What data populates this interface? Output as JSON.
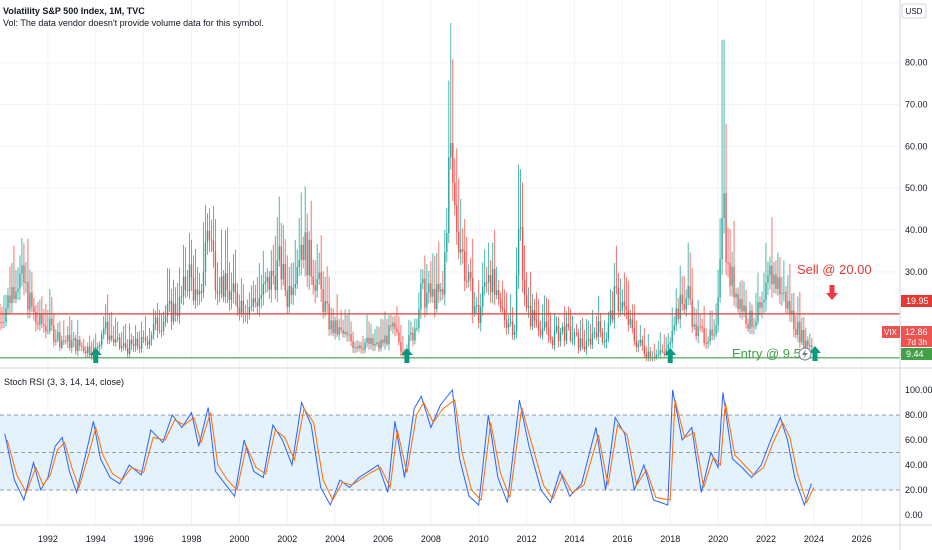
{
  "header": {
    "title": "Volatility S&P 500 Index, 1M, TVC",
    "volume_note": "Vol: The data vendor doesn't provide volume data for this symbol.",
    "currency": "USD"
  },
  "indicator": {
    "title": "Stoch RSI (3, 3, 14, 14, close)"
  },
  "annotations": {
    "sell_label": "Sell @ 20.00",
    "entry_label": "Entry @ 9.50"
  },
  "price_tags": {
    "sell_line_value": "19.95",
    "entry_line_value": "9.44",
    "symbol": "VIX",
    "last_price": "12.86",
    "countdown": "7d 3h"
  },
  "colors": {
    "up": "#26a69a",
    "down": "#ef5350",
    "sell_line": "#e53935",
    "entry_line": "#43a047",
    "arrow_up": "#089981",
    "arrow_down": "#f23645",
    "stoch_k": "#2962ff",
    "stoch_d": "#ff6d00",
    "stoch_band": "#e3f2fd"
  },
  "chart_data": [
    {
      "type": "candlestick",
      "title": "Volatility S&P 500 Index, 1M, TVC",
      "x_axis": {
        "type": "date",
        "range": [
          "1990-01",
          "2027-06"
        ],
        "tick_labels": [
          "1992",
          "1994",
          "1996",
          "1998",
          "2000",
          "2002",
          "2004",
          "2006",
          "2008",
          "2010",
          "2012",
          "2014",
          "2016",
          "2018",
          "2020",
          "2022",
          "2024",
          "2026"
        ]
      },
      "y_axis": {
        "range": [
          7,
          95
        ],
        "tick_labels": [
          "30.00",
          "40.00",
          "50.00",
          "60.00",
          "70.00",
          "80.00"
        ]
      },
      "horizontal_lines": [
        {
          "value": 19.95,
          "label": "19.95"
        },
        {
          "value": 9.44,
          "label": "9.44"
        }
      ],
      "series_shape": {
        "wick_highs": [
          [
            2008.8,
            89.5
          ],
          [
            2020.2,
            85.5
          ]
        ],
        "approx_closes": [
          [
            1990.0,
            18
          ],
          [
            1990.7,
            29
          ],
          [
            1991.0,
            27
          ],
          [
            1991.5,
            18
          ],
          [
            1992.0,
            17
          ],
          [
            1992.5,
            14
          ],
          [
            1993.0,
            13
          ],
          [
            1993.5,
            12
          ],
          [
            1994.0,
            11
          ],
          [
            1994.3,
            17
          ],
          [
            1994.8,
            13
          ],
          [
            1995.0,
            12
          ],
          [
            1995.5,
            12
          ],
          [
            1996.0,
            13
          ],
          [
            1996.5,
            17
          ],
          [
            1997.0,
            20
          ],
          [
            1997.5,
            22
          ],
          [
            1997.9,
            30
          ],
          [
            1998.3,
            21
          ],
          [
            1998.7,
            42
          ],
          [
            1999.0,
            30
          ],
          [
            1999.5,
            25
          ],
          [
            2000.0,
            23
          ],
          [
            2000.5,
            22
          ],
          [
            2001.0,
            25
          ],
          [
            2001.7,
            32
          ],
          [
            2002.0,
            24
          ],
          [
            2002.6,
            38
          ],
          [
            2002.9,
            33
          ],
          [
            2003.3,
            27
          ],
          [
            2003.8,
            17
          ],
          [
            2004.3,
            15
          ],
          [
            2004.8,
            13
          ],
          [
            2005.3,
            13
          ],
          [
            2005.8,
            12
          ],
          [
            2006.4,
            16
          ],
          [
            2006.9,
            11
          ],
          [
            2007.3,
            16
          ],
          [
            2007.6,
            25
          ],
          [
            2008.0,
            24
          ],
          [
            2008.5,
            24
          ],
          [
            2008.8,
            60
          ],
          [
            2009.0,
            45
          ],
          [
            2009.5,
            28
          ],
          [
            2010.0,
            19
          ],
          [
            2010.4,
            32
          ],
          [
            2010.8,
            21
          ],
          [
            2011.5,
            17
          ],
          [
            2011.7,
            43
          ],
          [
            2012.0,
            20
          ],
          [
            2012.5,
            18
          ],
          [
            2013.0,
            14
          ],
          [
            2013.5,
            16
          ],
          [
            2014.0,
            14
          ],
          [
            2014.5,
            12
          ],
          [
            2014.9,
            17
          ],
          [
            2015.3,
            14
          ],
          [
            2015.7,
            24
          ],
          [
            2016.0,
            22
          ],
          [
            2016.5,
            14
          ],
          [
            2017.0,
            11
          ],
          [
            2017.5,
            10
          ],
          [
            2017.9,
            11
          ],
          [
            2018.1,
            19
          ],
          [
            2018.8,
            25
          ],
          [
            2019.0,
            16
          ],
          [
            2019.5,
            15
          ],
          [
            2019.9,
            13
          ],
          [
            2020.2,
            53
          ],
          [
            2020.4,
            30
          ],
          [
            2020.8,
            25
          ],
          [
            2021.3,
            18
          ],
          [
            2021.9,
            21
          ],
          [
            2022.2,
            30
          ],
          [
            2022.6,
            26
          ],
          [
            2022.9,
            22
          ],
          [
            2023.2,
            18
          ],
          [
            2023.6,
            13
          ],
          [
            2023.9,
            12.86
          ]
        ]
      }
    },
    {
      "type": "line",
      "title": "Stoch RSI (3, 3, 14, 14, close)",
      "y_axis": {
        "range": [
          -8,
          108
        ],
        "tick_labels": [
          "0.00",
          "20.00",
          "40.00",
          "60.00",
          "80.00",
          "100.00"
        ]
      },
      "bands": {
        "upper": 80,
        "middle": 50,
        "lower": 20
      },
      "series": [
        {
          "color": "#2962ff",
          "points": [
            [
              1990.2,
              65
            ],
            [
              1990.6,
              28
            ],
            [
              1991.0,
              12
            ],
            [
              1991.4,
              42
            ],
            [
              1991.7,
              20
            ],
            [
              1992.0,
              30
            ],
            [
              1992.3,
              55
            ],
            [
              1992.6,
              62
            ],
            [
              1992.9,
              35
            ],
            [
              1993.2,
              18
            ],
            [
              1993.6,
              50
            ],
            [
              1993.9,
              75
            ],
            [
              1994.2,
              45
            ],
            [
              1994.6,
              30
            ],
            [
              1995.0,
              25
            ],
            [
              1995.4,
              40
            ],
            [
              1995.9,
              32
            ],
            [
              1996.3,
              68
            ],
            [
              1996.8,
              58
            ],
            [
              1997.2,
              80
            ],
            [
              1997.6,
              70
            ],
            [
              1998.0,
              82
            ],
            [
              1998.3,
              55
            ],
            [
              1998.7,
              86
            ],
            [
              1999.0,
              35
            ],
            [
              1999.4,
              25
            ],
            [
              1999.8,
              15
            ],
            [
              2000.2,
              60
            ],
            [
              2000.6,
              35
            ],
            [
              2001.0,
              30
            ],
            [
              2001.4,
              72
            ],
            [
              2001.8,
              60
            ],
            [
              2002.2,
              40
            ],
            [
              2002.6,
              90
            ],
            [
              2003.0,
              72
            ],
            [
              2003.4,
              22
            ],
            [
              2003.8,
              8
            ],
            [
              2004.2,
              28
            ],
            [
              2004.6,
              22
            ],
            [
              2005.0,
              30
            ],
            [
              2005.4,
              35
            ],
            [
              2005.8,
              40
            ],
            [
              2006.2,
              18
            ],
            [
              2006.5,
              75
            ],
            [
              2006.9,
              30
            ],
            [
              2007.3,
              85
            ],
            [
              2007.6,
              95
            ],
            [
              2008.0,
              70
            ],
            [
              2008.4,
              88
            ],
            [
              2008.9,
              100
            ],
            [
              2009.2,
              45
            ],
            [
              2009.6,
              15
            ],
            [
              2010.0,
              8
            ],
            [
              2010.4,
              80
            ],
            [
              2010.8,
              30
            ],
            [
              2011.2,
              10
            ],
            [
              2011.7,
              92
            ],
            [
              2012.1,
              55
            ],
            [
              2012.6,
              20
            ],
            [
              2013.0,
              10
            ],
            [
              2013.4,
              35
            ],
            [
              2013.8,
              15
            ],
            [
              2014.3,
              25
            ],
            [
              2014.9,
              70
            ],
            [
              2015.3,
              20
            ],
            [
              2015.7,
              78
            ],
            [
              2016.1,
              65
            ],
            [
              2016.5,
              20
            ],
            [
              2016.9,
              40
            ],
            [
              2017.3,
              12
            ],
            [
              2017.9,
              8
            ],
            [
              2018.1,
              100
            ],
            [
              2018.5,
              60
            ],
            [
              2018.9,
              70
            ],
            [
              2019.3,
              18
            ],
            [
              2019.7,
              50
            ],
            [
              2020.0,
              38
            ],
            [
              2020.2,
              98
            ],
            [
              2020.6,
              45
            ],
            [
              2021.0,
              38
            ],
            [
              2021.4,
              30
            ],
            [
              2021.8,
              40
            ],
            [
              2022.2,
              60
            ],
            [
              2022.6,
              78
            ],
            [
              2022.9,
              60
            ],
            [
              2023.2,
              30
            ],
            [
              2023.6,
              8
            ],
            [
              2023.9,
              25
            ]
          ]
        },
        {
          "color": "#ff6d00",
          "points": [
            [
              1990.3,
              60
            ],
            [
              1990.7,
              32
            ],
            [
              1991.1,
              18
            ],
            [
              1991.5,
              38
            ],
            [
              1991.8,
              24
            ],
            [
              1992.1,
              32
            ],
            [
              1992.4,
              52
            ],
            [
              1992.7,
              58
            ],
            [
              1993.0,
              38
            ],
            [
              1993.3,
              22
            ],
            [
              1993.7,
              48
            ],
            [
              1994.0,
              70
            ],
            [
              1994.3,
              48
            ],
            [
              1994.7,
              33
            ],
            [
              1995.1,
              28
            ],
            [
              1995.5,
              38
            ],
            [
              1996.0,
              34
            ],
            [
              1996.4,
              62
            ],
            [
              1996.9,
              60
            ],
            [
              1997.3,
              76
            ],
            [
              1997.7,
              72
            ],
            [
              1998.1,
              78
            ],
            [
              1998.4,
              58
            ],
            [
              1998.8,
              82
            ],
            [
              1999.1,
              40
            ],
            [
              1999.5,
              28
            ],
            [
              1999.9,
              20
            ],
            [
              2000.3,
              55
            ],
            [
              2000.7,
              38
            ],
            [
              2001.1,
              33
            ],
            [
              2001.5,
              68
            ],
            [
              2001.9,
              62
            ],
            [
              2002.3,
              44
            ],
            [
              2002.7,
              85
            ],
            [
              2003.1,
              74
            ],
            [
              2003.5,
              28
            ],
            [
              2003.9,
              12
            ],
            [
              2004.3,
              26
            ],
            [
              2004.7,
              24
            ],
            [
              2005.1,
              29
            ],
            [
              2005.5,
              34
            ],
            [
              2005.9,
              38
            ],
            [
              2006.3,
              22
            ],
            [
              2006.6,
              68
            ],
            [
              2007.0,
              34
            ],
            [
              2007.4,
              80
            ],
            [
              2007.7,
              90
            ],
            [
              2008.1,
              74
            ],
            [
              2008.5,
              85
            ],
            [
              2009.0,
              92
            ],
            [
              2009.3,
              50
            ],
            [
              2009.7,
              20
            ],
            [
              2010.1,
              12
            ],
            [
              2010.5,
              74
            ],
            [
              2010.9,
              34
            ],
            [
              2011.3,
              14
            ],
            [
              2011.8,
              86
            ],
            [
              2012.2,
              58
            ],
            [
              2012.7,
              24
            ],
            [
              2013.1,
              13
            ],
            [
              2013.5,
              32
            ],
            [
              2013.9,
              18
            ],
            [
              2014.4,
              24
            ],
            [
              2015.0,
              64
            ],
            [
              2015.4,
              24
            ],
            [
              2015.8,
              72
            ],
            [
              2016.2,
              64
            ],
            [
              2016.6,
              24
            ],
            [
              2017.0,
              36
            ],
            [
              2017.4,
              14
            ],
            [
              2018.0,
              12
            ],
            [
              2018.2,
              92
            ],
            [
              2018.6,
              62
            ],
            [
              2019.0,
              66
            ],
            [
              2019.4,
              22
            ],
            [
              2019.8,
              46
            ],
            [
              2020.1,
              40
            ],
            [
              2020.3,
              90
            ],
            [
              2020.7,
              48
            ],
            [
              2021.1,
              40
            ],
            [
              2021.5,
              32
            ],
            [
              2021.9,
              38
            ],
            [
              2022.3,
              58
            ],
            [
              2022.7,
              74
            ],
            [
              2023.0,
              62
            ],
            [
              2023.3,
              34
            ],
            [
              2023.7,
              10
            ],
            [
              2024.0,
              22
            ]
          ]
        }
      ]
    }
  ]
}
